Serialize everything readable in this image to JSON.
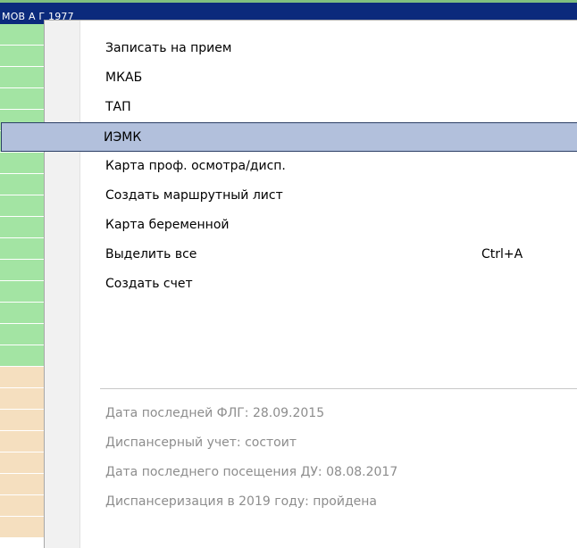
{
  "background_grid": {
    "header_text": "МОВ      А           Г              1977",
    "row_colors": [
      "green",
      "green",
      "green",
      "green",
      "green",
      "green",
      "green",
      "green",
      "green",
      "green",
      "green",
      "green",
      "green",
      "green",
      "green",
      "green",
      "tan",
      "tan",
      "tan",
      "tan",
      "tan",
      "tan",
      "tan",
      "tan"
    ],
    "colors": {
      "header": "#0b2a7c",
      "green_row": "#a3e4a3",
      "tan_row": "#f5dfbf"
    }
  },
  "context_menu": {
    "items": [
      {
        "label": "Записать на прием",
        "shortcut": "",
        "state": "normal"
      },
      {
        "label": "МКАБ",
        "shortcut": "",
        "state": "normal"
      },
      {
        "label": "ТАП",
        "shortcut": "",
        "state": "normal"
      },
      {
        "label": "ИЭМК",
        "shortcut": "",
        "state": "highlighted"
      },
      {
        "label": "Карта проф. осмотра/дисп.",
        "shortcut": "",
        "state": "normal"
      },
      {
        "label": "Создать маршрутный лист",
        "shortcut": "",
        "state": "normal"
      },
      {
        "label": "Карта беременной",
        "shortcut": "",
        "state": "normal"
      },
      {
        "label": "Выделить все",
        "shortcut": "Ctrl+A",
        "state": "normal"
      },
      {
        "label": "Создать счет",
        "shortcut": "",
        "state": "normal"
      }
    ],
    "info_items": [
      {
        "label": "Дата последней ФЛГ: 28.09.2015"
      },
      {
        "label": "Диспансерный учет: состоит"
      },
      {
        "label": "Дата последнего посещения ДУ: 08.08.2017"
      },
      {
        "label": "Диспансеризация в 2019 году: пройдена"
      }
    ],
    "colors": {
      "highlight_bg": "#b2c0dc",
      "highlight_border": "#2b3f66",
      "info_text": "#8d8d8d"
    }
  }
}
